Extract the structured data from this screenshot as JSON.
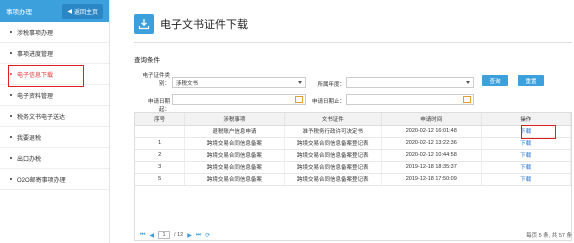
{
  "sidebar": {
    "title": "事项办理",
    "back_label": "返回主页",
    "items": [
      {
        "label": "涉税事项办理"
      },
      {
        "label": "事项进度管理"
      },
      {
        "label": "电子信息下载"
      },
      {
        "label": "电子资料管理"
      },
      {
        "label": "税务文书电子送达"
      },
      {
        "label": "我要退税"
      },
      {
        "label": "出口办税"
      },
      {
        "label": "O2O邮寄事项办理"
      }
    ]
  },
  "page": {
    "title": "电子文书证件下载",
    "section": "查询条件"
  },
  "form": {
    "cert_type_label": "电子证件类别：",
    "cert_type_value": "涉税文书",
    "year_label": "所属年度：",
    "year_value": "",
    "start_label": "申请日期起：",
    "end_label": "申请日期止：",
    "query_btn": "查询",
    "reset_btn": "重置"
  },
  "table": {
    "headers": [
      "序号",
      "涉税事项",
      "文书证件",
      "申请时间",
      "操作"
    ],
    "rows": [
      [
        "",
        "退税账户信息申请",
        "准予税务行政许可决定书",
        "2020-02-12 16:01:48",
        "下载"
      ],
      [
        "1",
        "跨境交易合同信息备案",
        "跨境交易合同信息备案登记表",
        "2020-02-12 13:22:36",
        "下载"
      ],
      [
        "2",
        "跨境交易合同信息备案",
        "跨境交易合同信息备案登记表",
        "2020-02-12 10:44:58",
        "下载"
      ],
      [
        "3",
        "跨境交易合同信息备案",
        "跨境交易合同信息备案登记表",
        "2019-12-18 18:35:37",
        "下载"
      ],
      [
        "5",
        "跨境交易合同信息备案",
        "跨境交易合同信息备案登记表",
        "2019-12-18 17:50:09",
        "下载"
      ]
    ]
  },
  "pager": {
    "page": "1",
    "total_pages": "/ 12",
    "summary": "每页 5 条, 共 57 条"
  }
}
